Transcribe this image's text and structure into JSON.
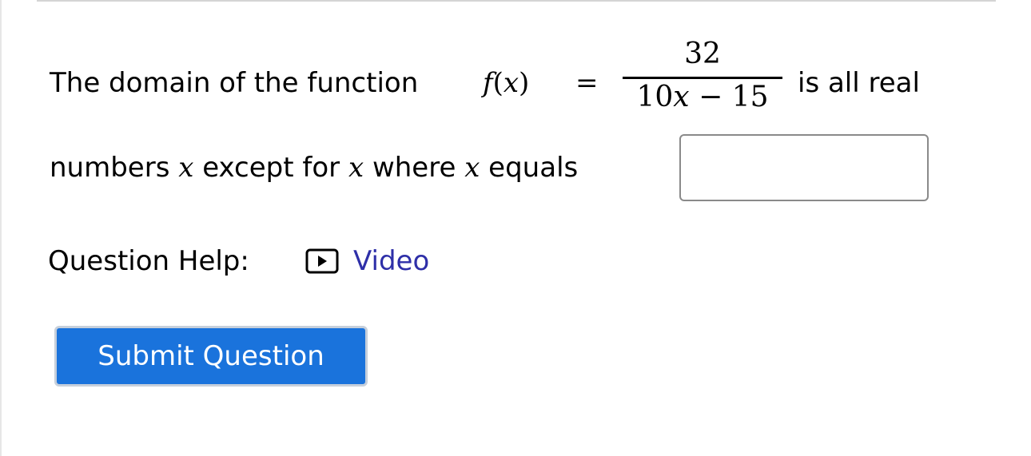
{
  "question": {
    "text_before": "The domain of the function ",
    "func_name": "f",
    "func_var": "x",
    "equals": "=",
    "numerator": "32",
    "denominator_coef": "10",
    "denominator_var": "x",
    "denominator_op": "−",
    "denominator_const": "15",
    "text_after": "is all real",
    "line2_start": "numbers ",
    "var": "x",
    "line2_mid1": " except for ",
    "line2_mid2": " where ",
    "line2_end": " equals",
    "answer_value": ""
  },
  "help": {
    "label": "Question Help:",
    "video_icon": "play-video-icon",
    "video_label": "Video"
  },
  "submit": {
    "label": "Submit Question",
    "color": "#1a73dc"
  }
}
